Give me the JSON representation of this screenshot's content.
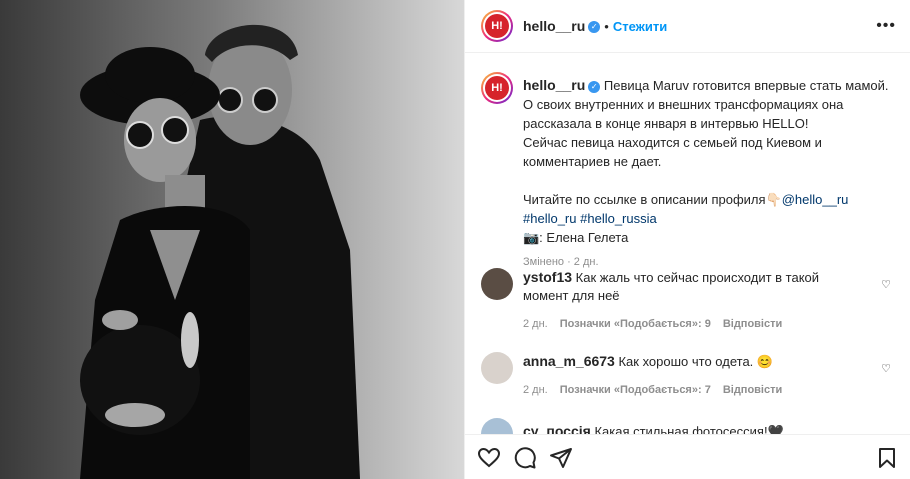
{
  "post": {
    "username": "hello__ru",
    "follow_label": "Стежити",
    "avatar_text": "H!"
  },
  "caption": {
    "username": "hello__ru",
    "line1": "Певица Maruv готовится впервые стать мамой. О своих внутренних и внешних трансформациях она рассказала в конце января в интервью HELLO!",
    "line2": "Сейчас певица находится с семьей под Киевом и комментариев не дает.",
    "line3_text": "Читайте по ссылке в описании профиля👇🏻",
    "mention": "@hello__ru",
    "tag1": "#hello_ru",
    "tag2": "#hello_russia",
    "photo_credit": "📷: Елена Гелета",
    "edited": "Змінено · 2 дн."
  },
  "comments": [
    {
      "username": "ystof13",
      "text": "Как жаль что сейчас происходит в такой момент для неё",
      "time": "2 дн.",
      "likes": "Позначки «Подобається»: 9",
      "reply": "Відповісти"
    },
    {
      "username": "anna_m_6673",
      "text": "Как хорошо что одета. 😊",
      "time": "2 дн.",
      "likes": "Позначки «Подобається»: 7",
      "reply": "Відповісти"
    },
    {
      "username": "су_поссія",
      "text": "Какая стильная фотосессия!🖤"
    }
  ],
  "icons": [
    "heart-icon",
    "comment-icon",
    "share-icon",
    "bookmark-icon",
    "more-icon",
    "verified-icon"
  ],
  "colors": {
    "accent": "#0095f6",
    "verified": "#3897f0",
    "logo": "#d6232b"
  }
}
